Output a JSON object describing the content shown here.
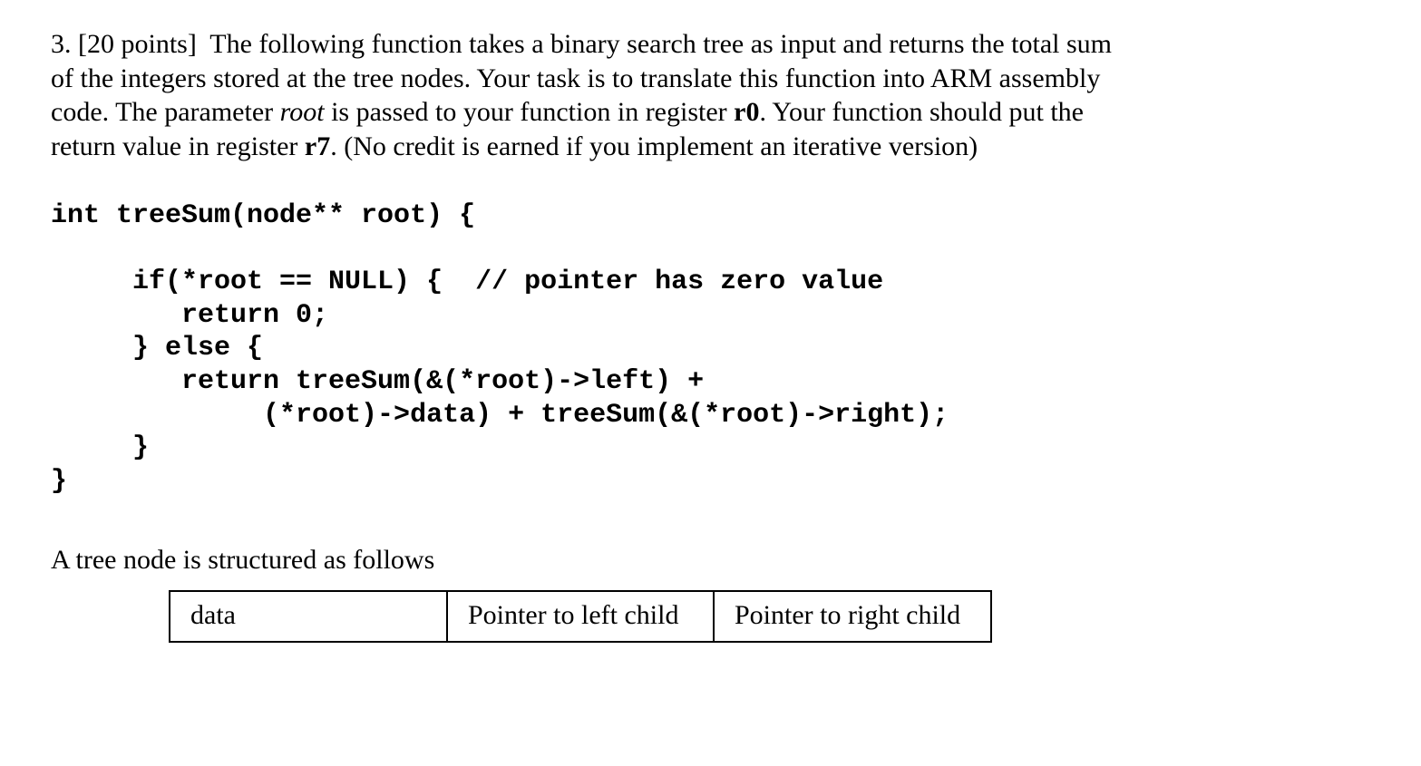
{
  "problem": {
    "number": "3.",
    "points": "[20 points]",
    "text_line1": "The following function takes a binary search tree as input and returns the total sum",
    "text_line2_a": "of  the integers stored at the tree nodes. Your task is to translate this function into ARM assembly",
    "text_line3_a": "code. The parameter ",
    "param_root": "root",
    "text_line3_b": " is passed to your function in register ",
    "reg_r0": "r0",
    "text_line3_c": ". Your function should put the",
    "text_line4_a": "return value in register ",
    "reg_r7": "r7",
    "text_line4_b": ". (No credit is earned if you implement an iterative version)"
  },
  "code": {
    "l1": "int treeSum(node** root) {",
    "l2": "",
    "l3": "     if(*root == NULL) {  // pointer has zero value",
    "l4": "        return 0;",
    "l5": "     } else {",
    "l6": "        return treeSum(&(*root)->left) +",
    "l7": "             (*root)->data) + treeSum(&(*root)->right);",
    "l8": "     }",
    "l9": "}"
  },
  "struct_note": "A tree node is structured as follows",
  "node_layout": {
    "data": "data",
    "left": "Pointer to left child",
    "right": "Pointer to right child"
  }
}
